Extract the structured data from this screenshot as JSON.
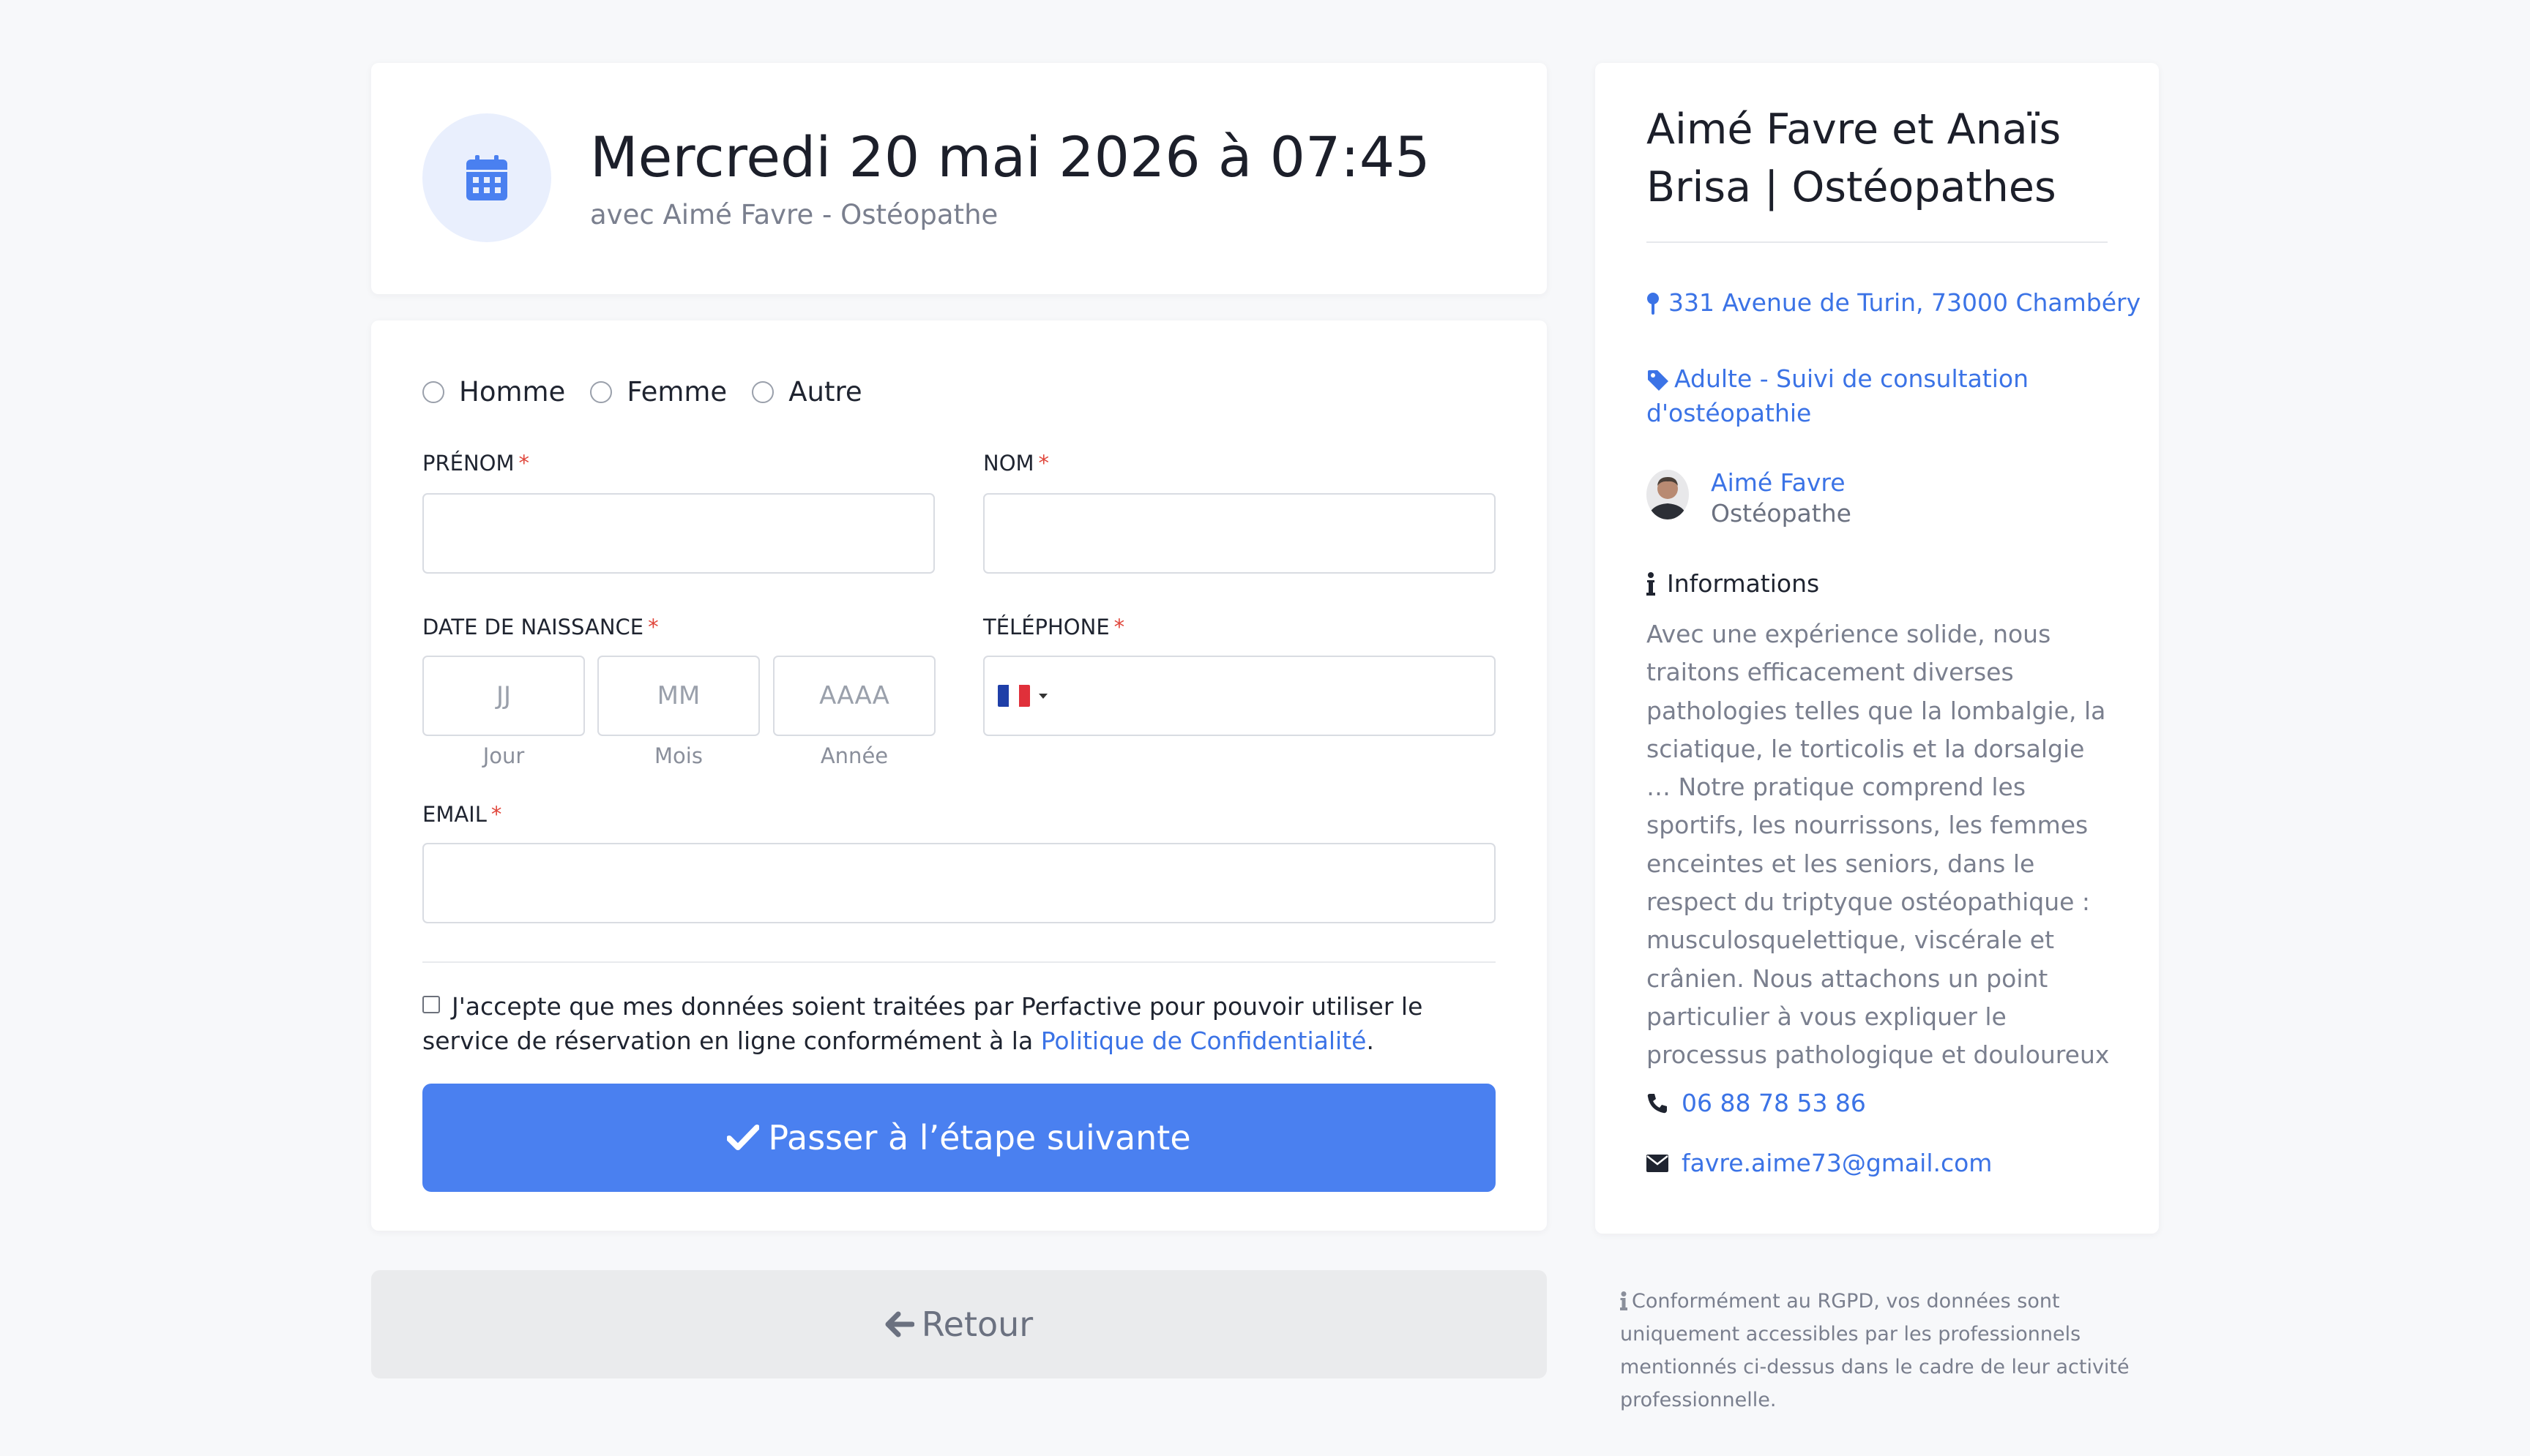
{
  "header": {
    "title": "Mercredi 20 mai 2026 à 07:45",
    "subtitle": "avec Aimé Favre - Ostéopathe",
    "icon": "calendar-icon"
  },
  "form": {
    "gender_options": [
      "Homme",
      "Femme",
      "Autre"
    ],
    "firstname_label": "PRÉNOM",
    "lastname_label": "NOM",
    "dob_label": "DATE DE NAISSANCE",
    "dob_day_placeholder": "JJ",
    "dob_month_placeholder": "MM",
    "dob_year_placeholder": "AAAA",
    "dob_day_label": "Jour",
    "dob_month_label": "Mois",
    "dob_year_label": "Année",
    "phone_label": "TÉLÉPHONE",
    "email_label": "EMAIL",
    "required_mark": "*",
    "consent_text": "J'accepte que mes données soient traitées par Perfactive pour pouvoir utiliser le service de réservation en ligne conformément à la ",
    "consent_link": "Politique de Confidentialité",
    "consent_end": ".",
    "next_button": "Passer à l’étape suivante",
    "back_button": "Retour"
  },
  "side": {
    "title": "Aimé Favre et Anaïs Brisa | Ostéopathes",
    "address": "331 Avenue de Turin, 73000 Chambéry",
    "service": "Adulte - Suivi de consultation d'ostéopathie",
    "practitioner_name": "Aimé Favre",
    "practitioner_role": "Ostéopathe",
    "info_title": "Informations",
    "info_text": "Avec une expérience solide, nous traitons efficacement diverses pathologies telles que la lombalgie, la sciatique, le torticolis et la dorsalgie … Notre pratique comprend les sportifs, les nourrissons, les femmes enceintes et les seniors, dans le respect du triptyque ostéopathique : musculosquelettique, viscérale et crânien. Nous attachons un point particulier à vous expliquer le processus pathologique et douloureux",
    "phone": "06 88 78 53 86",
    "email": "favre.aime73@gmail.com"
  },
  "gdpr_note": "Conformément au RGPD, vos données sont uniquement accessibles par les professionnels mentionnés ci-dessus dans le cadre de leur activité professionnelle.",
  "colors": {
    "accent": "#4a80f0",
    "link": "#3b73e6",
    "required": "#e0463b",
    "background": "#f7f8fa"
  }
}
